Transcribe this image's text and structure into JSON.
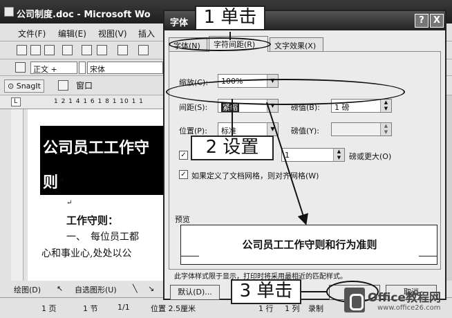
{
  "word_window": {
    "title": "公司制度.doc - Microsoft Wo",
    "menu": [
      "文件(F)",
      "编辑(E)",
      "视图(V)",
      "插入"
    ],
    "style_box": "正文 + Aria",
    "font_box": "宋体",
    "snagit_label": "SnagIt",
    "window_menu": "窗口",
    "ruler_text": "1 2 1 4 1 6 1 8 1 10 1 1",
    "doc": {
      "title_line1": "公司员工工作守",
      "title_line2": "则",
      "para_mark": "↵",
      "section_heading": "工作守则：",
      "line1": "一、　每位员工都",
      "line2": "心和事业心,处处以公"
    },
    "drawbar": {
      "draw_label": "绘图(D)",
      "autoshape_label": "自选图形(U)"
    },
    "status": {
      "page": "1 页",
      "section": "1 节",
      "pages": "1/1",
      "position": "位置 2.5厘米",
      "line": "1 行",
      "col": "1 列",
      "rec": "录制"
    }
  },
  "dialog": {
    "title": "字体",
    "help_btn": "?",
    "close_btn": "X",
    "tabs": [
      "字体(N)",
      "字符间距(R)",
      "文字效果(X)"
    ],
    "scale_label": "缩放(C):",
    "scale_value": "100%",
    "spacing_label": "间距(S):",
    "spacing_value": "紧缩",
    "spacing_pts_label": "磅值(B):",
    "spacing_pts_value": "1 磅",
    "position_label": "位置(P):",
    "position_value": "标准",
    "position_pts_label": "磅值(Y):",
    "kerning_check": "为",
    "kerning_value": "1",
    "kerning_suffix": "磅或更大(O)",
    "grid_check": "如果定义了文档网格，则对齐网格(W)",
    "preview_label": "预览",
    "preview_text": "公司员工工作守则和行为准则",
    "note": "此字体样式限于显示，打印时将采用最相近的匹配样式。",
    "default_btn": "默认(D)...",
    "ok_btn": "确定",
    "cancel_btn": "取消"
  },
  "callouts": {
    "step1": "1 单击",
    "step2": "2 设置",
    "step3": "3 单击"
  },
  "watermark": {
    "brand": "Office教程网",
    "url": "www.office26.com"
  }
}
